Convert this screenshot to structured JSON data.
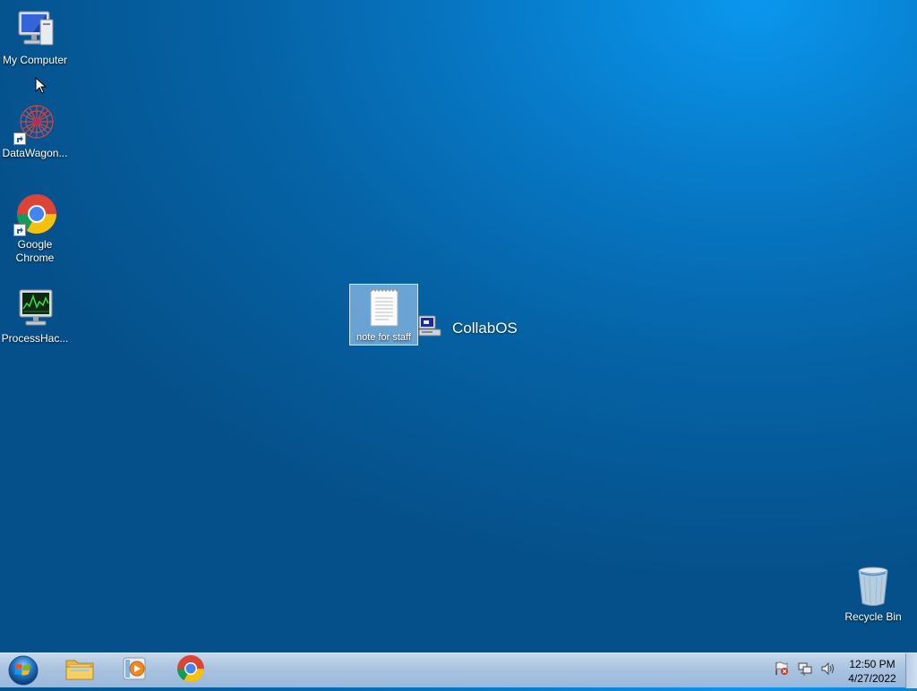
{
  "desktop": {
    "icons": [
      {
        "label": "My Computer",
        "icon": "computer-icon"
      },
      {
        "label": "DataWagon...",
        "icon": "datawagon-icon"
      },
      {
        "label": "Google Chrome",
        "icon": "chrome-icon"
      },
      {
        "label": "ProcessHac...",
        "icon": "process-hacker-icon"
      },
      {
        "label": "note for staff",
        "icon": "text-document-icon"
      },
      {
        "label": "Recycle Bin",
        "icon": "recycle-bin-icon"
      }
    ],
    "overlay_label": "CollabOS"
  },
  "taskbar": {
    "pinned": [
      {
        "name": "File Explorer",
        "icon": "folder-icon"
      },
      {
        "name": "Media Player",
        "icon": "media-player-icon"
      },
      {
        "name": "Google Chrome",
        "icon": "chrome-icon"
      }
    ],
    "tray_icons": [
      "action-center-flag-icon",
      "network-icon",
      "volume-icon"
    ],
    "time": "12:50 PM",
    "date": "4/27/2022"
  },
  "colors": {
    "desktop_bg": "#0670b8",
    "taskbar_bg": "#b3cbe5",
    "selection": "#bedcff"
  }
}
